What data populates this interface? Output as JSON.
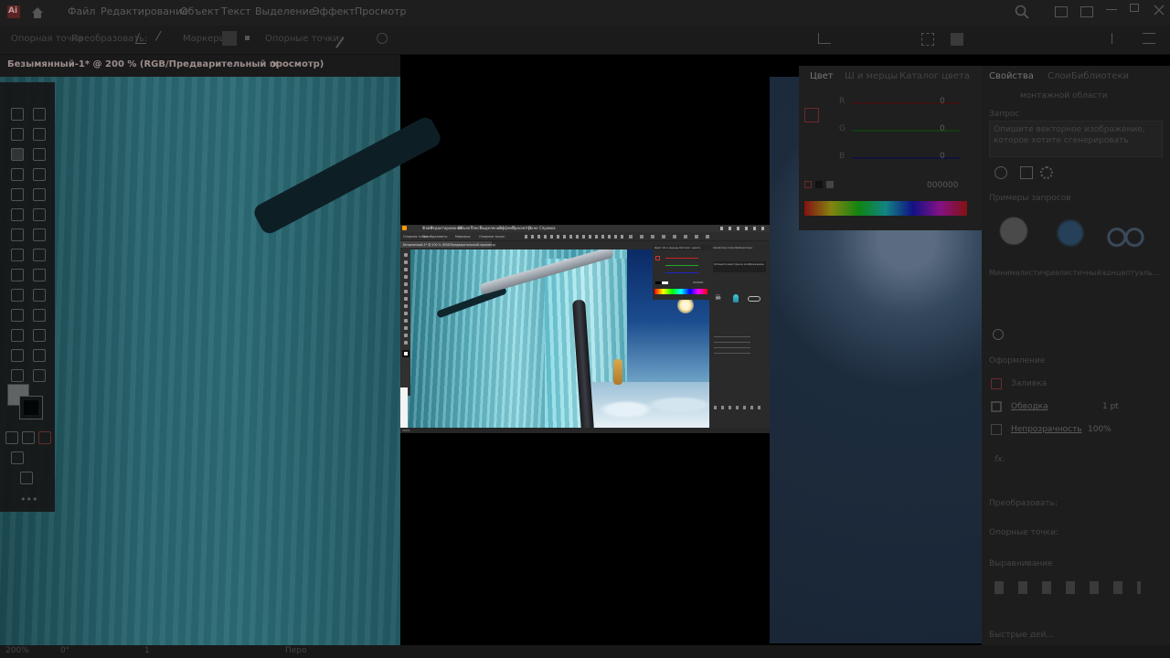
{
  "app": {
    "logo": "Ai",
    "menu": [
      "Файл",
      "Редактирование",
      "Объект",
      "Текст",
      "Выделение",
      "Эффект",
      "Просмотр"
    ]
  },
  "optbar": {
    "anchor_point": "Опорная точка",
    "transform": "Преобразовать:",
    "markers": "Маркеры:",
    "anchors": "Опорные точки:"
  },
  "document": {
    "tab_title": "Безымянный-1* @ 200 % (RGB/Предварительный просмотр)",
    "close": "×"
  },
  "color_panel": {
    "tabs": [
      "Цвет",
      "Ш и мерцы",
      "Каталог цвета"
    ],
    "r_label": "R",
    "g_label": "G",
    "b_label": "B",
    "r_value": "0",
    "g_value": "0",
    "b_value": "0",
    "hex": "000000"
  },
  "properties_panel": {
    "tabs": [
      "Свойства",
      "Слои",
      "Библиотеки"
    ],
    "artboard_text": "монтажной области",
    "prompt_label": "Запрос",
    "prompt_placeholder_1": "Опишите векторное изображение,",
    "prompt_placeholder_2": "которое хотите сгенерировать",
    "examples_label": "Примеры запросов",
    "example_1": "Минималистич...",
    "example_2": "реалистичный ...",
    "example_3": "концептуаль...",
    "appearance_label": "Оформление",
    "fill_label": "Заливка",
    "stroke_label": "Обводка",
    "stroke_value": "1 pt",
    "opacity_label": "Непрозрачность",
    "opacity_value": "100%",
    "fx_label": "fx.",
    "transform_label": "Преобразовать:",
    "anchors_label": "Опорные точки:",
    "align_label": "Выравнивание",
    "quick_actions_label": "Быстрые дей..."
  },
  "status": {
    "zoom": "200%",
    "angle": "0°",
    "page": "1",
    "tool": "Перо"
  },
  "mini": {
    "menu": [
      "Файл",
      "Редактирование",
      "Объект",
      "Текст",
      "Выделение",
      "Эффект",
      "Просмотр",
      "Окно",
      "Справка"
    ],
    "opt1": "Опорная точка",
    "opt2": "Преобразовать:",
    "opt3": "Маркеры:",
    "opt4": "Опорные точки:",
    "tab": "Безымянный-1* @ 200 % (RGB/Предварительный просмотр)",
    "color_tabs": "Цвет    Ш и мерцы    Каталог цвета",
    "props_tabs": "Свойства    Слои    Библиотеки",
    "hex": "000000",
    "prompt": "Опишите векторное изображение,",
    "zoom": "200%"
  }
}
